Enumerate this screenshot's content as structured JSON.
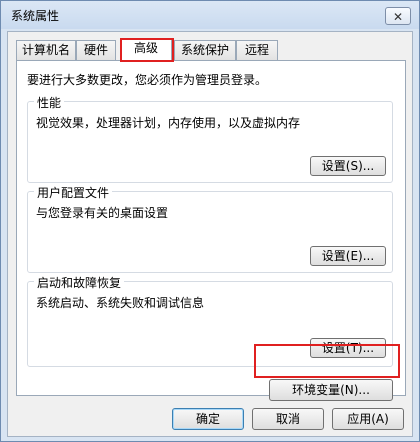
{
  "window": {
    "title": "系统属性",
    "close_glyph": "✕"
  },
  "tabs": [
    {
      "label": "计算机名",
      "active": false
    },
    {
      "label": "硬件",
      "active": false
    },
    {
      "label": "高级",
      "active": true
    },
    {
      "label": "系统保护",
      "active": false
    },
    {
      "label": "远程",
      "active": false
    }
  ],
  "advanced": {
    "intro": "要进行大多数更改，您必须作为管理员登录。",
    "performance": {
      "title": "性能",
      "description": "视觉效果，处理器计划，内存使用，以及虚拟内存",
      "settings_label": "设置(S)..."
    },
    "user_profiles": {
      "title": "用户配置文件",
      "description": "与您登录有关的桌面设置",
      "settings_label": "设置(E)..."
    },
    "startup_recovery": {
      "title": "启动和故障恢复",
      "description": "系统启动、系统失败和调试信息",
      "settings_label": "设置(T)..."
    },
    "env_vars_label": "环境变量(N)..."
  },
  "footer": {
    "ok_label": "确定",
    "cancel_label": "取消",
    "apply_label": "应用(A)"
  },
  "highlight_color": "#e02020"
}
